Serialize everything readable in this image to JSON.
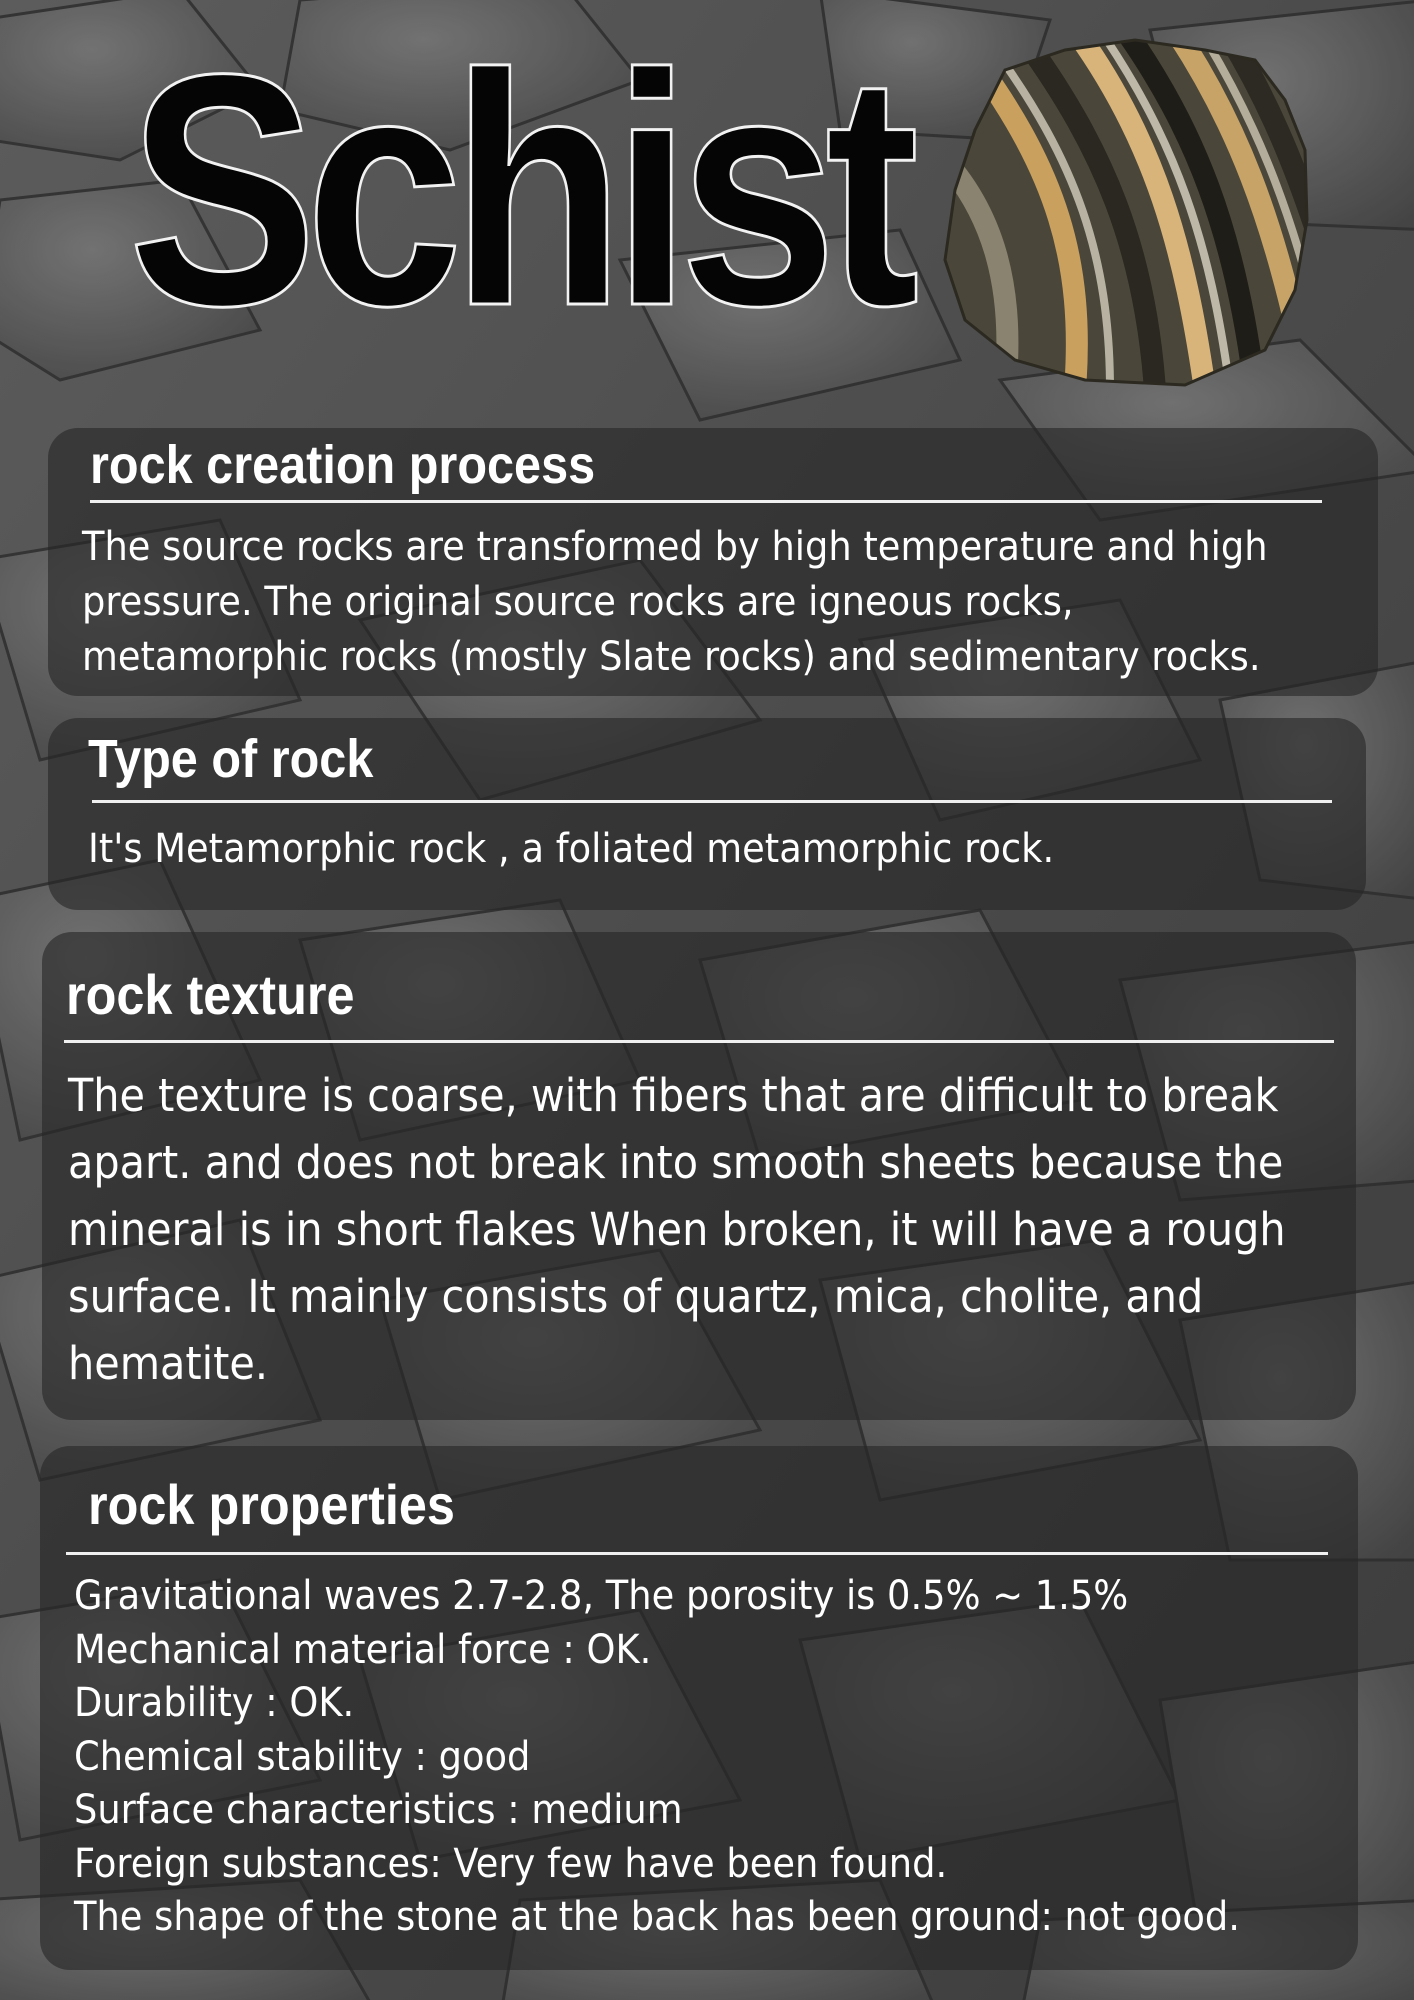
{
  "title": "Schist",
  "sections": {
    "creation": {
      "heading": "rock creation process",
      "lines": [
        "The source rocks are transformed by high temperature and high",
        "pressure. The original source rocks are igneous rocks,",
        "metamorphic rocks (mostly Slate rocks) and sedimentary rocks."
      ]
    },
    "type": {
      "heading": "Type of rock",
      "lines": [
        "It's Metamorphic rock , a foliated metamorphic rock."
      ]
    },
    "texture": {
      "heading": "rock texture",
      "lines": [
        "The texture is coarse, with fibers that are difficult to break",
        "apart. and does not break into smooth sheets because the",
        "mineral is in short flakes When broken, it will have a rough",
        "surface. It mainly consists of quartz, mica, cholite, and",
        "hematite."
      ]
    },
    "properties": {
      "heading": "rock properties",
      "lines": [
        "Gravitational waves 2.7-2.8, The porosity is 0.5% ~ 1.5%",
        "Mechanical material force : OK.",
        "Durability : OK.",
        "Chemical stability : good",
        "Surface characteristics : medium",
        "Foreign substances: Very few have been found.",
        "The shape of the stone at the back has been ground: not good."
      ]
    }
  },
  "colors": {
    "panel": "#262626",
    "text": "#ffffff",
    "title_fill": "#050505"
  }
}
